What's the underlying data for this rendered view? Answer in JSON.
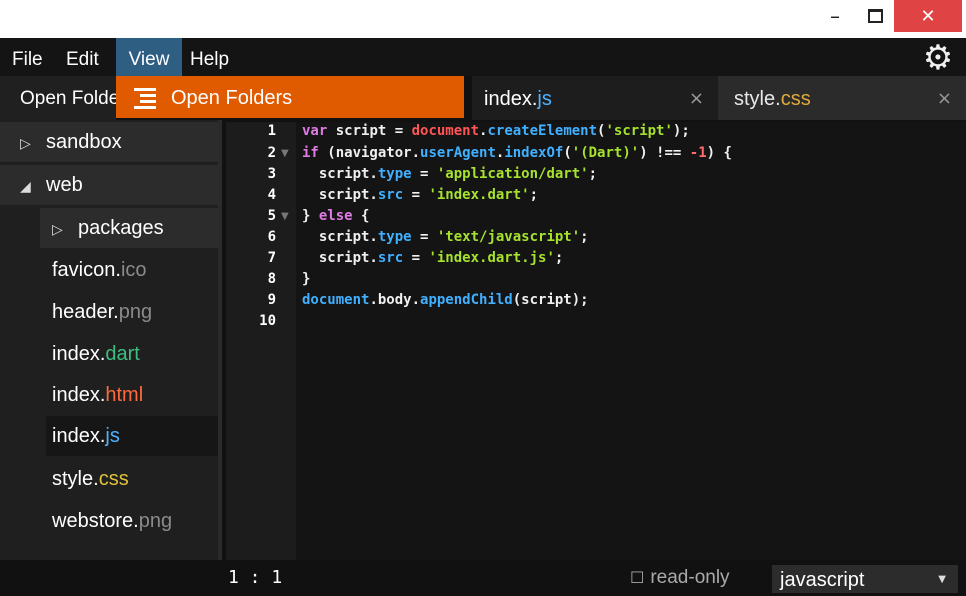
{
  "window": {
    "minimize_glyph": "–",
    "close_glyph": "✕"
  },
  "menu": {
    "file": "File",
    "edit": "Edit",
    "view": "View",
    "help": "Help",
    "settings_icon": "gear-icon"
  },
  "view_menu": {
    "items": [
      {
        "icon": "list-icon",
        "label": "Open Folders"
      }
    ]
  },
  "tabs": {
    "open_folders_label": "Open Folders",
    "editors": [
      {
        "name": "index.",
        "ext": "js",
        "ext_color": "#4fb2ff",
        "active": true
      },
      {
        "name": "style.",
        "ext": "css",
        "ext_color": "#e0a93b",
        "active": false
      }
    ],
    "close_glyph": "×"
  },
  "sidebar": {
    "folders": [
      {
        "label": "sandbox",
        "expanded": false,
        "arrow": "▷"
      },
      {
        "label": "web",
        "expanded": true,
        "arrow": "◢"
      },
      {
        "label": "packages",
        "expanded": false,
        "arrow": "▷"
      }
    ],
    "files": [
      {
        "name": "favicon.",
        "ext": "ico",
        "ext_color": "#8a8a8a",
        "selected": false
      },
      {
        "name": "header.",
        "ext": "png",
        "ext_color": "#8a8a8a",
        "selected": false
      },
      {
        "name": "index.",
        "ext": "dart",
        "ext_color": "#3fbf7f",
        "selected": false
      },
      {
        "name": "index.",
        "ext": "html",
        "ext_color": "#ff6a3d",
        "selected": false
      },
      {
        "name": "index.",
        "ext": "js",
        "ext_color": "#4fb2ff",
        "selected": true
      },
      {
        "name": "style.",
        "ext": "css",
        "ext_color": "#e0c23b",
        "selected": false
      },
      {
        "name": "webstore.",
        "ext": "png",
        "ext_color": "#8a8a8a",
        "selected": false
      }
    ]
  },
  "editor": {
    "line_numbers": [
      "1",
      "2",
      "3",
      "4",
      "5",
      "6",
      "7",
      "8",
      "9",
      "10"
    ],
    "fold_markers": [
      "2",
      "5"
    ],
    "code": [
      "var script = document.createElement('script');",
      "if (navigator.userAgent.indexOf('(Dart)') !== -1) {",
      "  script.type = 'application/dart';",
      "  script.src = 'index.dart';",
      "} else {",
      "  script.type = 'text/javascript';",
      "  script.src = 'index.dart.js';",
      "}",
      "document.body.appendChild(script);",
      ""
    ]
  },
  "status": {
    "cursor": "1 : 1",
    "readonly_box": "☐",
    "readonly_label": "read-only",
    "mode": "javascript",
    "mode_caret": "▼"
  }
}
